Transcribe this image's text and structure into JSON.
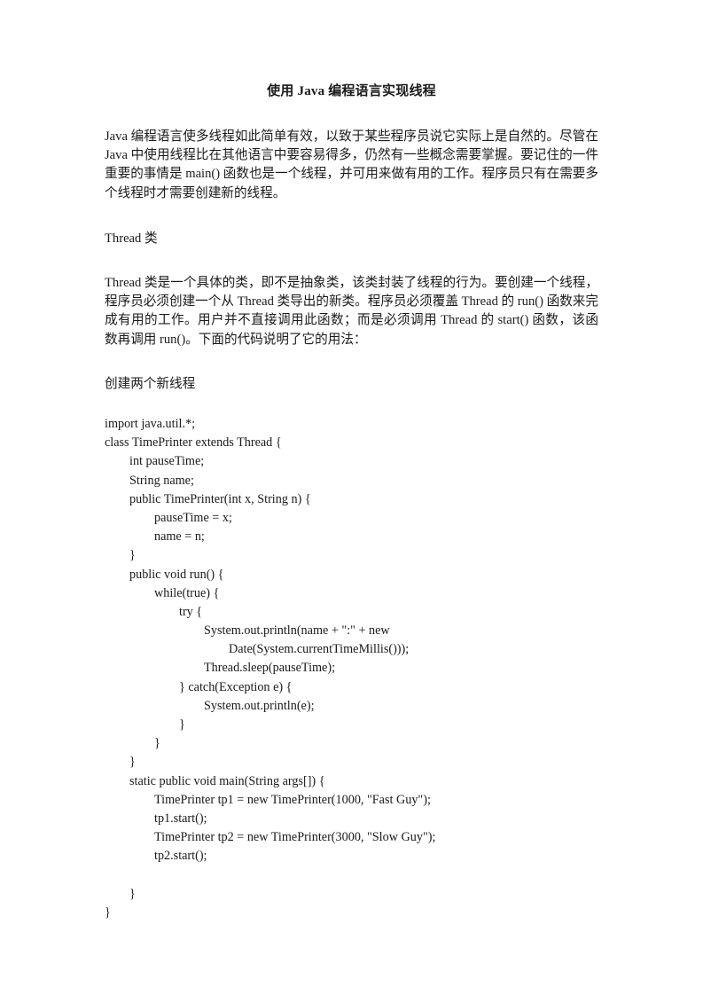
{
  "document": {
    "title": "使用 Java 编程语言实现线程",
    "paragraphs": {
      "intro": "Java 编程语言使多线程如此简单有效，以致于某些程序员说它实际上是自然的。尽管在 Java 中使用线程比在其他语言中要容易得多，仍然有一些概念需要掌握。要记住的一件重要的事情是 main() 函数也是一个线程，并可用来做有用的工作。程序员只有在需要多个线程时才需要创建新的线程。",
      "thread_heading": "Thread 类",
      "thread_body": "Thread 类是一个具体的类，即不是抽象类，该类封装了线程的行为。要创建一个线程，程序员必须创建一个从 Thread 类导出的新类。程序员必须覆盖 Thread 的 run() 函数来完成有用的工作。用户并不直接调用此函数；而是必须调用 Thread 的 start() 函数，该函数再调用 run()。下面的代码说明了它的用法：",
      "code_caption": "创建两个新线程"
    },
    "code": {
      "language": "java",
      "lines": [
        {
          "indent": 0,
          "text": "import java.util.*;"
        },
        {
          "indent": 0,
          "text": "class TimePrinter extends Thread {"
        },
        {
          "indent": 1,
          "text": "int pauseTime;"
        },
        {
          "indent": 1,
          "text": "String name;"
        },
        {
          "indent": 1,
          "text": "public TimePrinter(int x, String n) {"
        },
        {
          "indent": 2,
          "text": "pauseTime = x;"
        },
        {
          "indent": 2,
          "text": "name = n;"
        },
        {
          "indent": 1,
          "text": "}"
        },
        {
          "indent": 1,
          "text": "public void run() {"
        },
        {
          "indent": 2,
          "text": "while(true) {"
        },
        {
          "indent": 3,
          "text": "try {"
        },
        {
          "indent": 4,
          "text": "System.out.println(name + \":\" + new"
        },
        {
          "indent": 5,
          "text": "Date(System.currentTimeMillis()));"
        },
        {
          "indent": 4,
          "text": "Thread.sleep(pauseTime);"
        },
        {
          "indent": 3,
          "text": "} catch(Exception e) {"
        },
        {
          "indent": 4,
          "text": "System.out.println(e);"
        },
        {
          "indent": 3,
          "text": "}"
        },
        {
          "indent": 2,
          "text": "}"
        },
        {
          "indent": 1,
          "text": "}"
        },
        {
          "indent": 1,
          "text": "static public void main(String args[]) {"
        },
        {
          "indent": 2,
          "text": "TimePrinter tp1 = new TimePrinter(1000, \"Fast Guy\");"
        },
        {
          "indent": 2,
          "text": "tp1.start();"
        },
        {
          "indent": 2,
          "text": "TimePrinter tp2 = new TimePrinter(3000, \"Slow Guy\");"
        },
        {
          "indent": 2,
          "text": "tp2.start();"
        },
        {
          "indent": 0,
          "text": ""
        },
        {
          "indent": 1,
          "text": "}"
        },
        {
          "indent": 0,
          "text": "}"
        }
      ]
    }
  }
}
